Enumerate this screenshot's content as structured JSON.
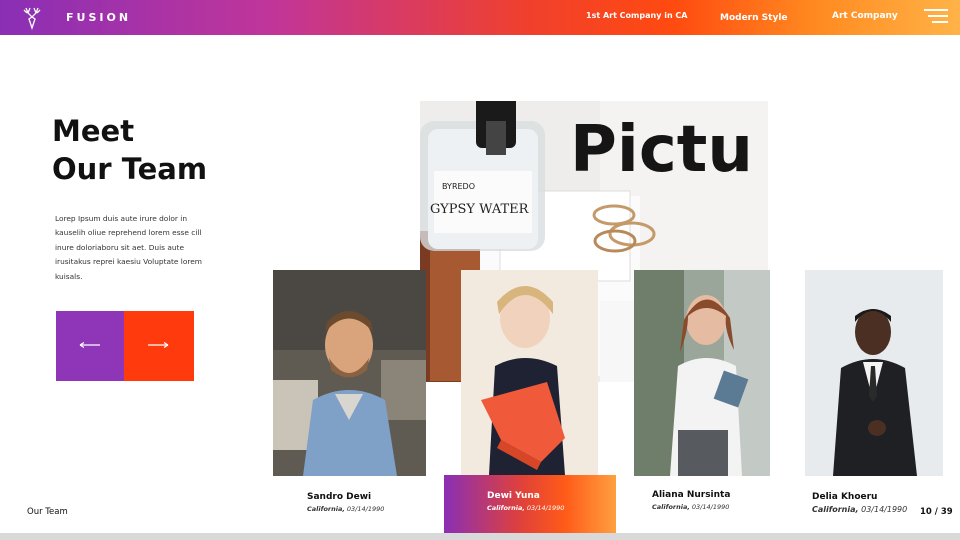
{
  "header": {
    "brand": "FUSION",
    "nav": [
      "1st Art Company in CA",
      "Modern Style",
      "Art Company"
    ],
    "menu_icon": "hamburger-menu-icon",
    "logo_icon": "deer-antler-logo-icon"
  },
  "hero": {
    "title_line1": "Meet",
    "title_line2": "Our Team",
    "paragraph": "Lorep  Ipsum duis aute irure dolor in kauselih oliue reprehend lorem esse cill inure doloriaboru sit aet. Duis aute irusitakus reprei kaesiu Voluptate lorem kuisals."
  },
  "controls": {
    "prev_icon": "arrow-left-icon",
    "next_icon": "arrow-right-icon"
  },
  "team": [
    {
      "name": "Sandro Dewi",
      "place": "California,",
      "date": "03/14/1990"
    },
    {
      "name": "Dewi Yuna",
      "place": "California,",
      "date": "03/14/1990"
    },
    {
      "name": "Aliana Nursinta",
      "place": "California,",
      "date": "03/14/1990"
    },
    {
      "name": "Delia Khoeru",
      "place": "California,",
      "date": "03/14/1990"
    }
  ],
  "footer": {
    "label": "Our Team",
    "page": "10 / 39"
  },
  "colors": {
    "purple": "#8e35b8",
    "orange": "#ff3a0c",
    "gradient_end": "#ffb347"
  }
}
